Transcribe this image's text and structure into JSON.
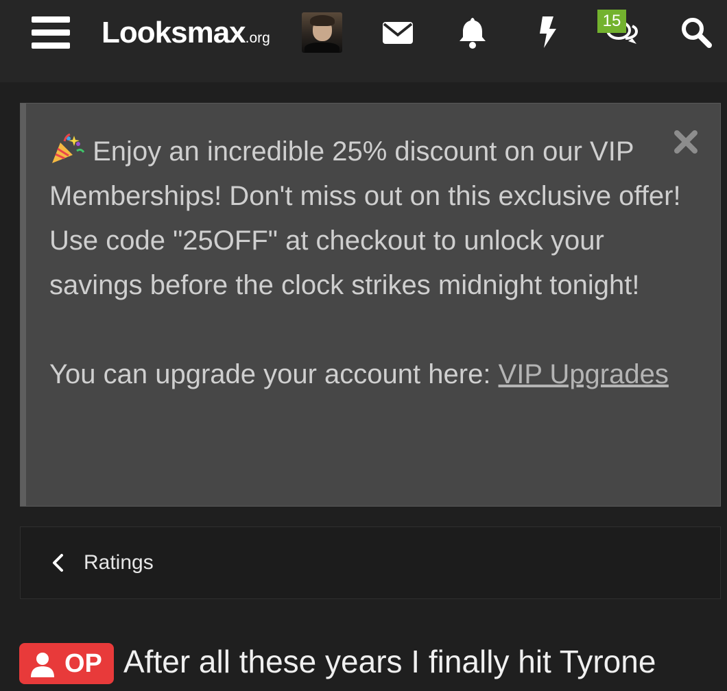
{
  "header": {
    "logo_main": "Looksmax",
    "logo_tld": ".org",
    "chat_badge_count": "15",
    "icons": [
      "menu-icon",
      "avatar",
      "envelope-icon",
      "bell-icon",
      "bolt-icon",
      "chat-icon",
      "search-icon"
    ],
    "accent_badge_color": "#73b22e"
  },
  "notice": {
    "line1": "Enjoy an incredible 25% discount on our VIP Memberships! Don't miss out on this exclusive offer! Use code \"25OFF\" at checkout to unlock your savings before the clock strikes midnight tonight!",
    "line2_prefix": "You can upgrade your account here: ",
    "link_text": "VIP Upgrades",
    "icon": "party-popper-icon",
    "close_icon": "close-icon"
  },
  "breadcrumb": {
    "label": "Ratings",
    "icon": "chevron-left-icon"
  },
  "thread": {
    "op_badge": "OP",
    "op_badge_color": "#e83a3a",
    "title": "After all these years I finally hit Tyrone"
  }
}
